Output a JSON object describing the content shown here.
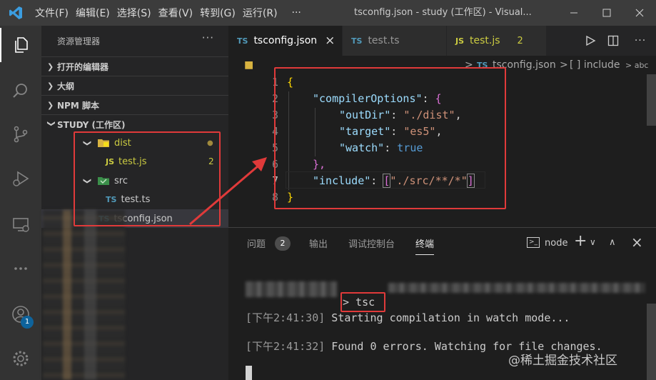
{
  "menu": [
    "文件(F)",
    "编辑(E)",
    "选择(S)",
    "查看(V)",
    "转到(G)",
    "运行(R)",
    "···"
  ],
  "window_title": "tsconfig.json - study (工作区) - Visual...",
  "explorer": {
    "title": "资源管理器",
    "more": "···",
    "sections": [
      "打开的编辑器",
      "大纲",
      "NPM 脚本",
      "STUDY (工作区)"
    ],
    "tree": [
      {
        "name": "dist",
        "icon": "JS-folder",
        "badge": "●"
      },
      {
        "name": "test.js",
        "icon_text": "JS",
        "badge": "2"
      },
      {
        "name": "src",
        "icon": "folder"
      },
      {
        "name": "test.ts",
        "icon_text": "TS"
      },
      {
        "name": "tsconfig.json",
        "icon_text": "TS"
      }
    ]
  },
  "activity_badge": "1",
  "tabs": [
    {
      "label": "tsconfig.json",
      "icon_text": "TS",
      "close": "×"
    },
    {
      "label": "test.ts",
      "icon_text": "TS"
    },
    {
      "label": "test.js",
      "icon_text": "JS",
      "badge": "2"
    }
  ],
  "breadcrumb": {
    "file": "tsconfig.json",
    "sep": ">",
    "item": "[ ] include",
    "tail": "> abc"
  },
  "code": {
    "lines": [
      "1",
      "2",
      "3",
      "4",
      "5",
      "6",
      "7",
      "8"
    ],
    "l1": "{",
    "l2_key": "\"compilerOptions\"",
    "l2_rest": ": ",
    "l2_brace": "{",
    "l3_key": "\"outDir\"",
    "l3_val": "\"./dist\"",
    "l4_key": "\"target\"",
    "l4_val": "\"es5\"",
    "l5_key": "\"watch\"",
    "l5_val": "true",
    "l6": "},",
    "l7_key": "\"include\"",
    "l7_open": "[",
    "l7_val": "\"./src/**/*\"",
    "l7_close": "]",
    "l8": "}",
    "colon": ": ",
    "comma": ","
  },
  "panel": {
    "tabs": [
      "问题",
      "输出",
      "调试控制台",
      "终端"
    ],
    "problems_badge": "2",
    "shell": "node",
    "plus": "+",
    "chevron": "∨",
    "up": "∧",
    "close": "×"
  },
  "terminal": {
    "prompt": "> tsc",
    "line1_time": "[下午2:41:30]",
    "line1_text": " Starting compilation in watch mode...",
    "line2_time": "[下午2:41:32]",
    "line2_text": " Found 0 errors. Watching for file changes."
  },
  "watermark": "@稀土掘金技术社区",
  "colors": {
    "annotation": "#e03a3a",
    "accent": "#0e639c",
    "js_yellow": "#cbcb41",
    "ts_blue": "#519aba"
  }
}
